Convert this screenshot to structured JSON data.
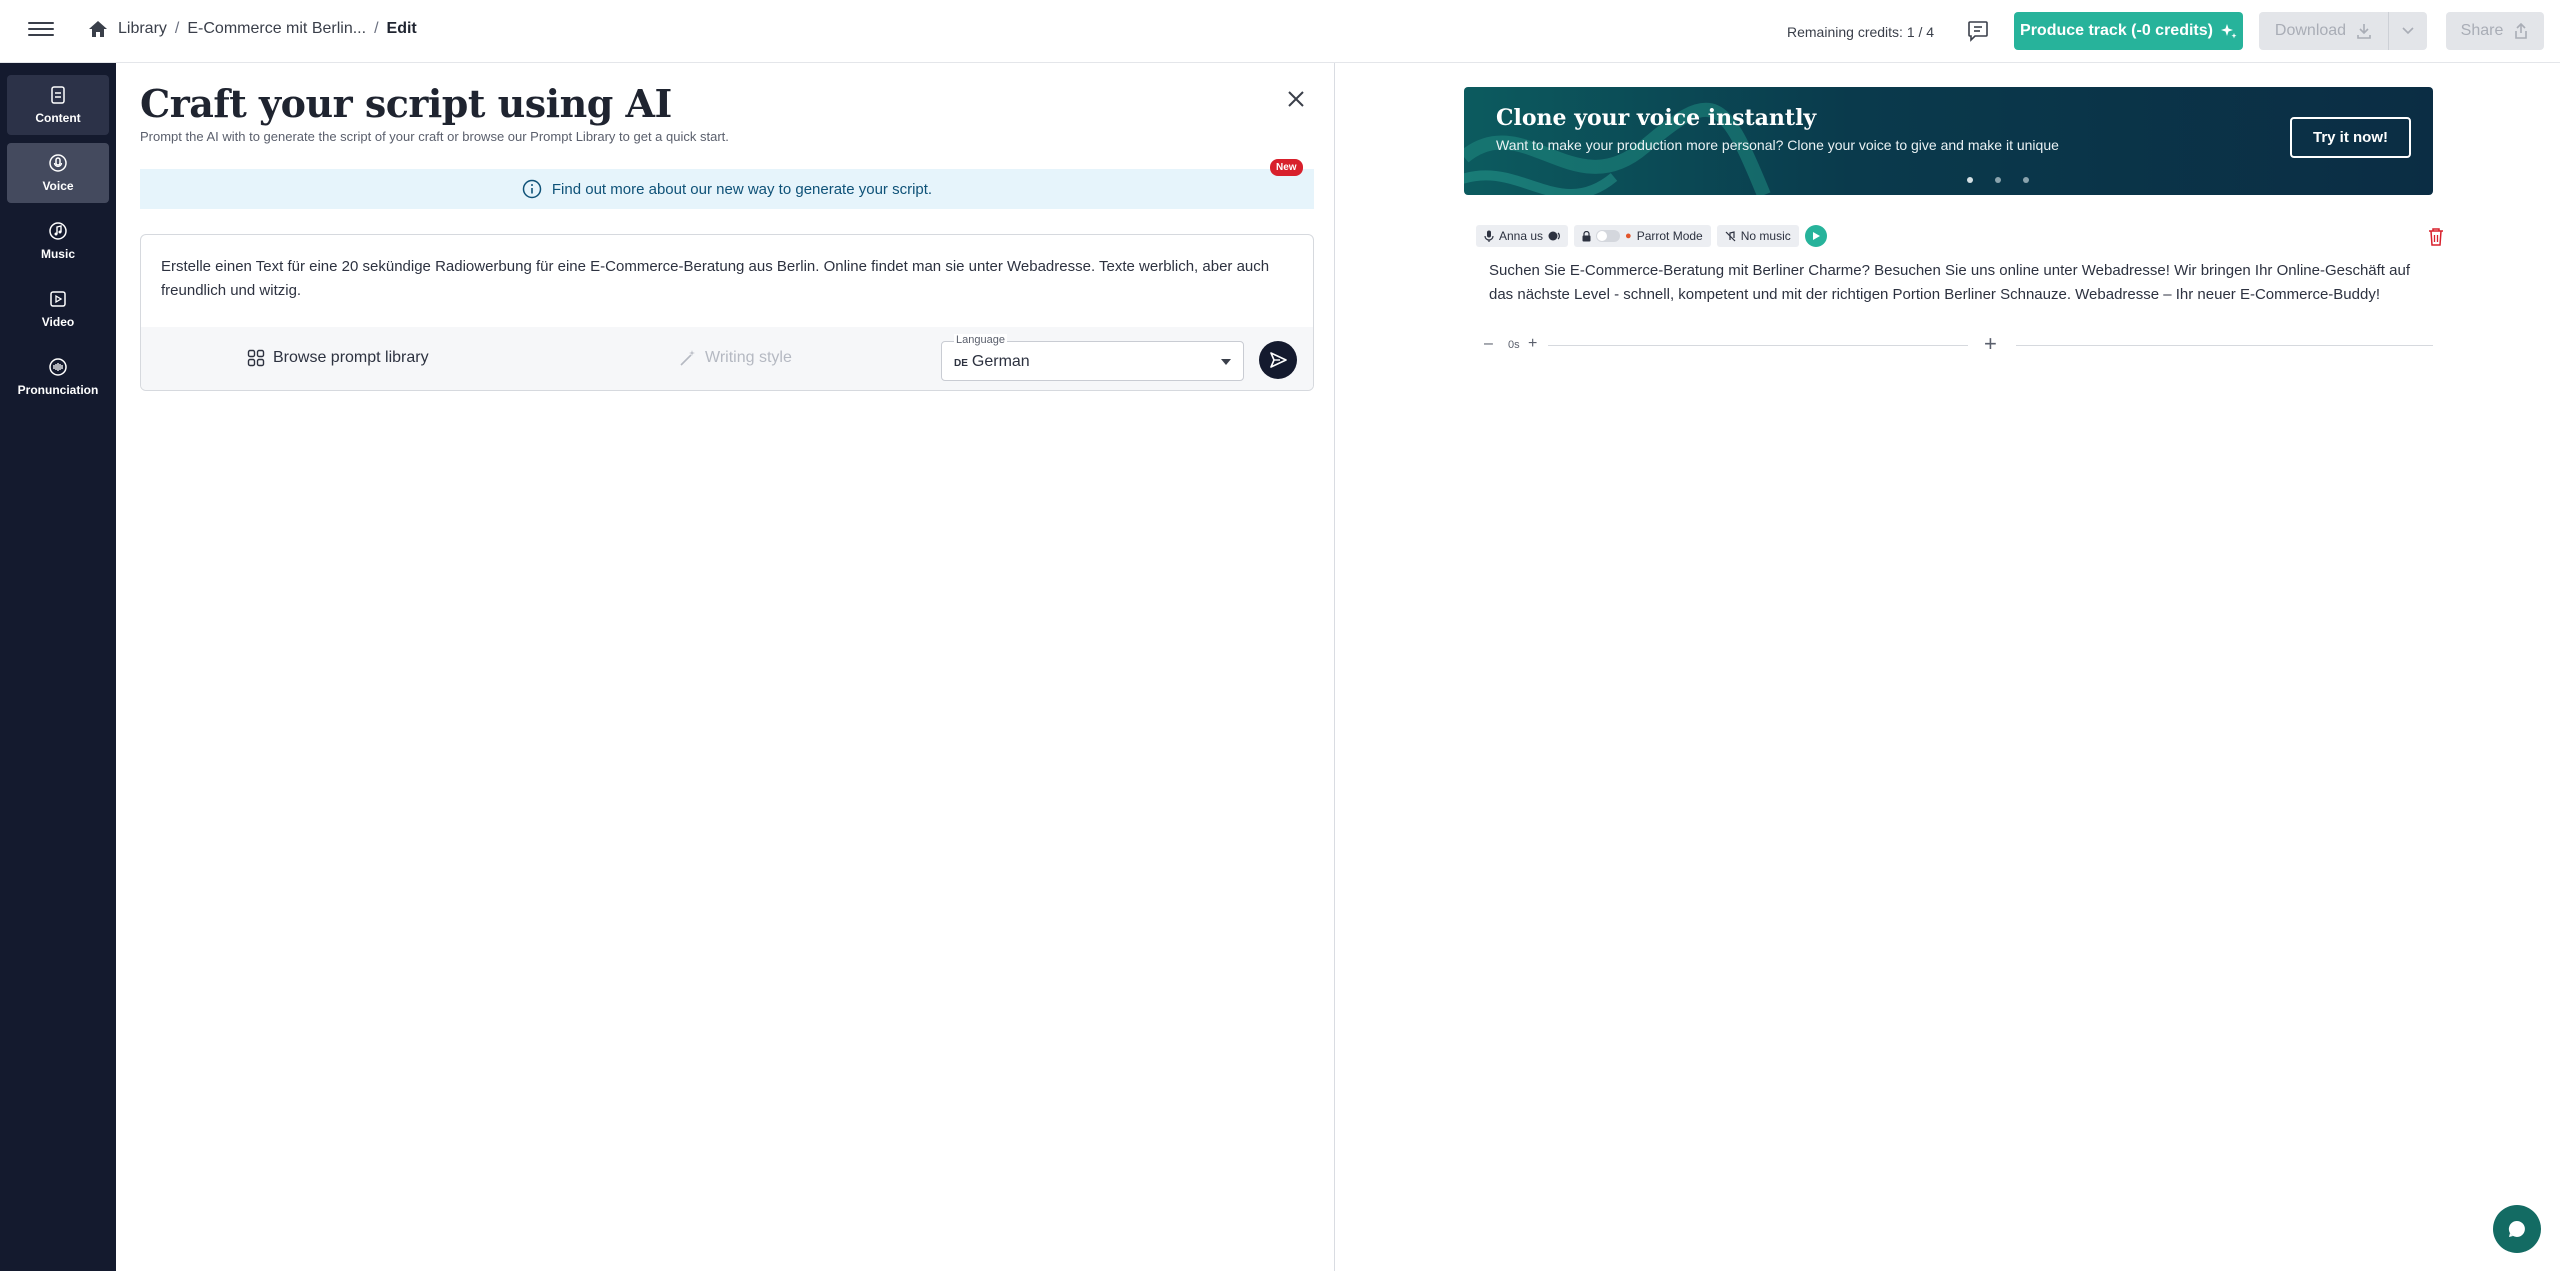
{
  "topbar": {
    "breadcrumb": [
      "Library",
      "E-Commerce mit Berlin...",
      "Edit"
    ],
    "credits_text": "Remaining credits: 1 / 4",
    "produce_label": "Produce track (-0 credits)",
    "download_label": "Download",
    "share_label": "Share"
  },
  "sidebar": {
    "items": [
      {
        "label": "Content",
        "icon": "content-icon"
      },
      {
        "label": "Voice",
        "icon": "voice-icon"
      },
      {
        "label": "Music",
        "icon": "music-icon"
      },
      {
        "label": "Video",
        "icon": "video-icon"
      },
      {
        "label": "Pronunciation",
        "icon": "pronunciation-icon"
      }
    ]
  },
  "craft": {
    "title": "Craft your script using AI",
    "subtitle": "Prompt the AI with to generate the script of your craft or browse our Prompt Library to get a quick start.",
    "banner_text": "Find out more about our new way to generate your script.",
    "new_badge": "New",
    "prompt_text": "Erstelle einen Text für eine 20 sekündige Radiowerbung für eine E-Commerce-Beratung aus Berlin. Online findet man sie unter Webadresse. Texte werblich, aber auch freundlich und witzig.",
    "browse_label": "Browse prompt library",
    "style_label": "Writing style",
    "language_label": "Language",
    "language_code": "DE",
    "language_value": "German"
  },
  "promo": {
    "title": "Clone your voice instantly",
    "subtitle": "Want to make your production more personal? Clone your voice to give and make it unique",
    "button": "Try it now!",
    "slides": 3,
    "active_slide": 1
  },
  "track": {
    "voice_chip": "Anna us",
    "parrot_label": "Parrot Mode",
    "music_chip": "No music",
    "text": "Suchen Sie E-Commerce-Beratung mit Berliner Charme? Besuchen Sie uns online unter Webadresse! Wir bringen Ihr Online-Geschäft auf das nächste Level - schnell, kompetent und mit der richtigen Portion Berliner Schnauze. Webadresse – Ihr neuer E-Commerce-Buddy!",
    "pause_value": "0s"
  },
  "colors": {
    "accent": "#27b39b",
    "sidebar": "#141a2e",
    "badge": "#d8202c"
  }
}
